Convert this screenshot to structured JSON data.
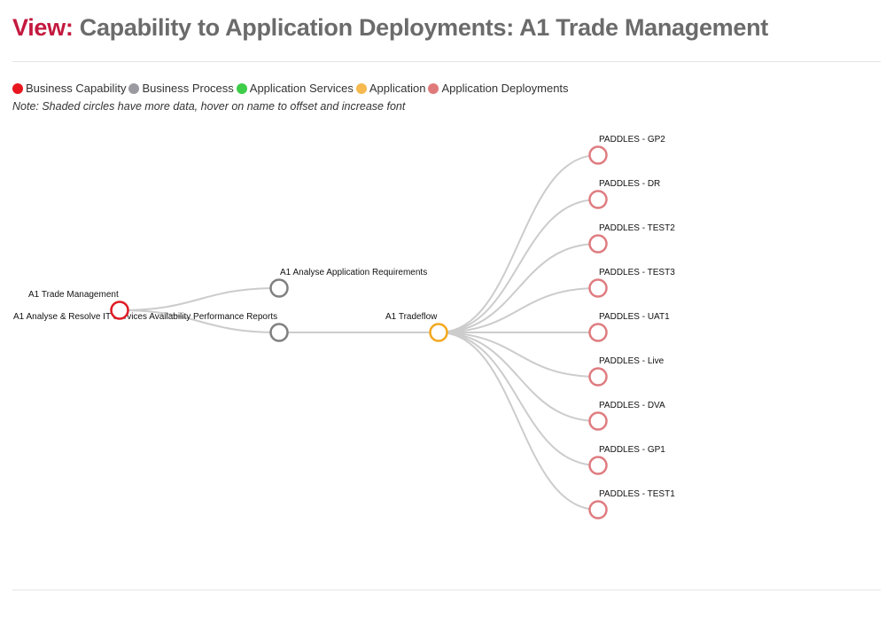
{
  "header": {
    "prefix": "View:",
    "title": "Capability to Application Deployments: A1 Trade Management"
  },
  "legend": [
    {
      "label": "Business Capability",
      "color": "#e8161f"
    },
    {
      "label": "Business Process",
      "color": "#9a9aa0"
    },
    {
      "label": "Application Services",
      "color": "#3dcd49"
    },
    {
      "label": "Application",
      "color": "#f5b94d"
    },
    {
      "label": "Application Deployments",
      "color": "#e07a7a"
    }
  ],
  "note": "Note: Shaded circles have more data, hover on name to offset and increase font",
  "colors": {
    "capability": "#dd1b23",
    "process": "#808080",
    "application": "#f3a81e",
    "deployment": "#df7c80",
    "link": "#cccccc"
  },
  "diagram": {
    "capability": {
      "label": "A1 Trade Management"
    },
    "processes": [
      {
        "label": "A1 Analyse Application Requirements"
      },
      {
        "label": "A1 Analyse & Resolve IT Services Availability Performance Reports"
      }
    ],
    "application": {
      "label": "A1 Tradeflow"
    },
    "deployments": [
      {
        "label": "PADDLES - GP2"
      },
      {
        "label": "PADDLES - DR"
      },
      {
        "label": "PADDLES - TEST2"
      },
      {
        "label": "PADDLES - TEST3"
      },
      {
        "label": "PADDLES - UAT1"
      },
      {
        "label": "PADDLES - Live"
      },
      {
        "label": "PADDLES - DVA"
      },
      {
        "label": "PADDLES - GP1"
      },
      {
        "label": "PADDLES - TEST1"
      }
    ]
  }
}
